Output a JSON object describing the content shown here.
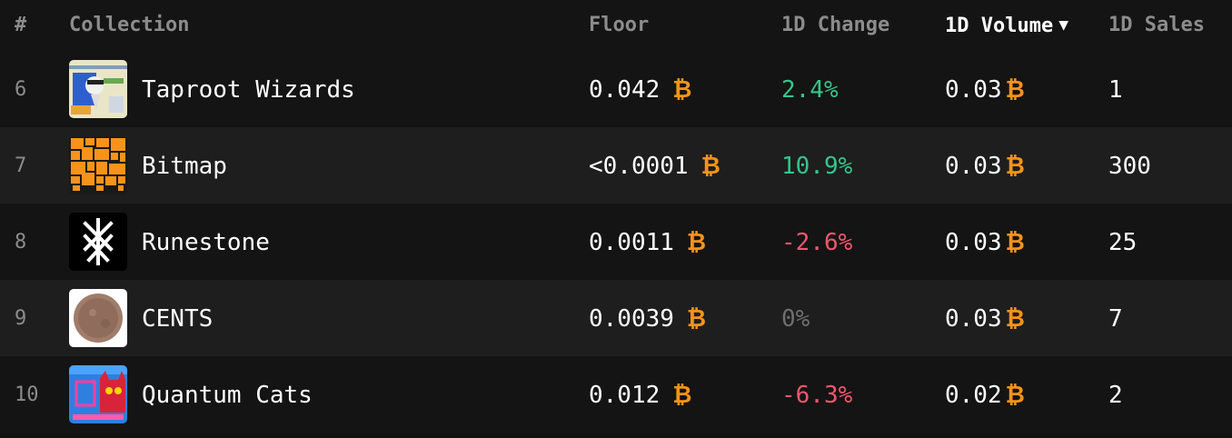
{
  "header": {
    "rank": "#",
    "collection": "Collection",
    "floor": "Floor",
    "change": "1D Change",
    "volume": "1D Volume",
    "volume_sort_icon": "sort-desc-icon",
    "sales": "1D Sales"
  },
  "currency": {
    "symbol": "₿",
    "color": "#f7931a"
  },
  "colors": {
    "positive": "#35c58a",
    "negative": "#f0566b",
    "neutral": "#6f6f6f"
  },
  "rows": [
    {
      "rank": "6",
      "name": "Taproot Wizards",
      "floor": "0.042",
      "change": "2.4%",
      "trend": "pos",
      "volume": "0.03",
      "sales": "1"
    },
    {
      "rank": "7",
      "name": "Bitmap",
      "floor": "<0.0001",
      "change": "10.9%",
      "trend": "pos",
      "volume": "0.03",
      "sales": "300"
    },
    {
      "rank": "8",
      "name": "Runestone",
      "floor": "0.0011",
      "change": "-2.6%",
      "trend": "neg",
      "volume": "0.03",
      "sales": "25"
    },
    {
      "rank": "9",
      "name": "CENTS",
      "floor": "0.0039",
      "change": "0%",
      "trend": "zero",
      "volume": "0.03",
      "sales": "7"
    },
    {
      "rank": "10",
      "name": "Quantum Cats",
      "floor": "0.012",
      "change": "-6.3%",
      "trend": "neg",
      "volume": "0.02",
      "sales": "2"
    }
  ]
}
